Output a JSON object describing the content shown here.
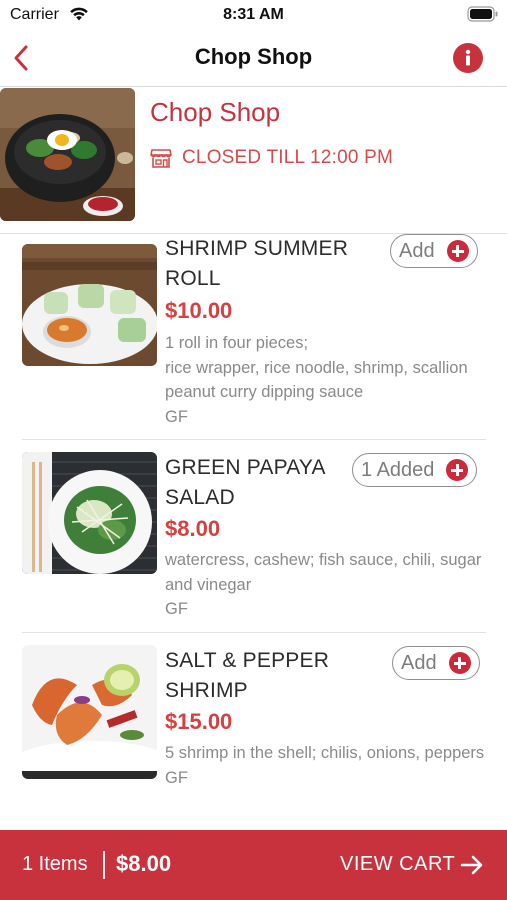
{
  "status_bar": {
    "carrier": "Carrier",
    "time": "8:31 AM"
  },
  "nav": {
    "title": "Chop Shop"
  },
  "restaurant": {
    "name": "Chop Shop",
    "status": "CLOSED TILL 12:00 PM"
  },
  "menu": {
    "items": [
      {
        "name": "SHRIMP SUMMER ROLL",
        "price": "$10.00",
        "description": "1 roll in four pieces;\nrice wrapper, rice noodle, shrimp, scallion peanut curry dipping sauce\nGF",
        "button": "Add"
      },
      {
        "name": "GREEN PAPAYA SALAD",
        "price": "$8.00",
        "description": "watercress, cashew;  fish sauce, chili, sugar and vinegar\nGF",
        "button": "1 Added"
      },
      {
        "name": "SALT & PEPPER SHRIMP",
        "price": "$15.00",
        "description": "5 shrimp in the shell; chilis, onions, peppers\nGF",
        "button": "Add"
      }
    ]
  },
  "cart": {
    "count": "1 Items",
    "total": "$8.00",
    "view_label": "VIEW CART"
  },
  "colors": {
    "accent": "#c8323c",
    "price": "#d8403f"
  }
}
